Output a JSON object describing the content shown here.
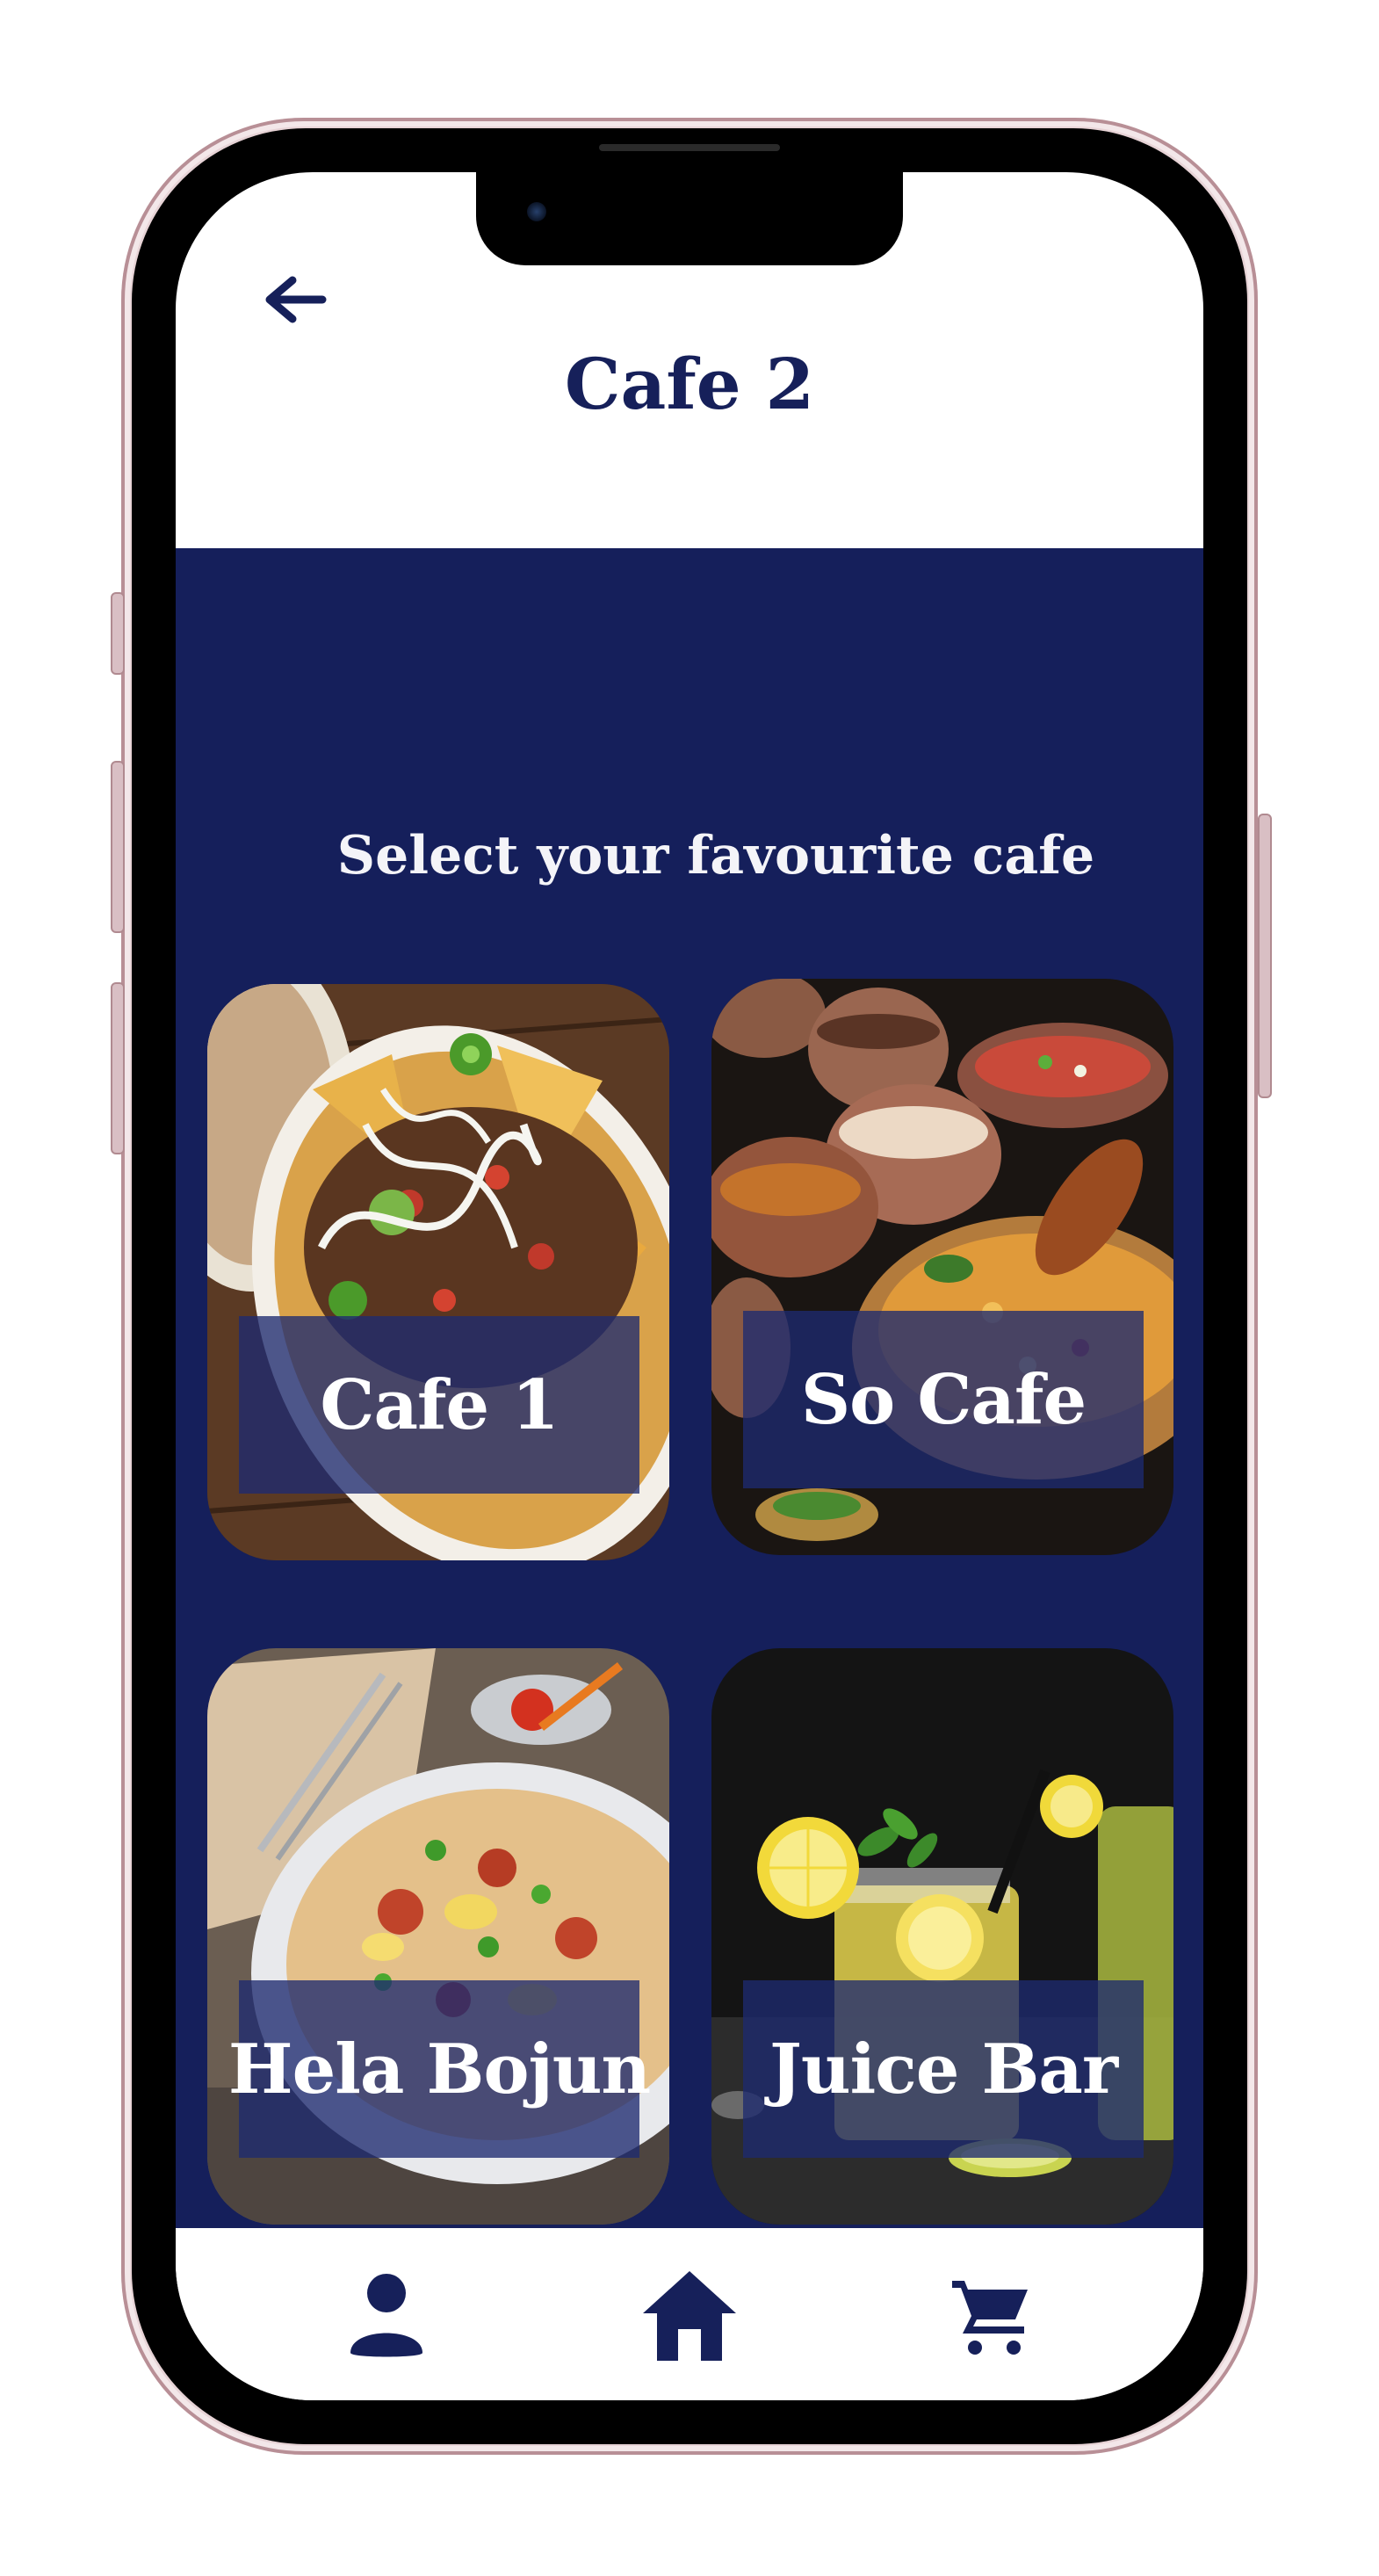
{
  "header": {
    "title": "Cafe 2",
    "back_icon": "arrow-left-icon"
  },
  "main": {
    "subtitle": "Select your favourite cafe",
    "cafes": [
      {
        "label": "Cafe 1",
        "image": "nachos-photo"
      },
      {
        "label": "So Cafe",
        "image": "biryani-photo"
      },
      {
        "label": "Hela Bojun",
        "image": "fried-rice-photo"
      },
      {
        "label": "Juice Bar",
        "image": "lemonade-photo"
      }
    ]
  },
  "bottom_nav": {
    "items": [
      {
        "icon": "person-icon"
      },
      {
        "icon": "home-icon"
      },
      {
        "icon": "cart-icon"
      }
    ]
  },
  "colors": {
    "primary_navy": "#151f5b",
    "title_navy": "#16205a",
    "label_overlay": "rgba(30,42,112,0.78)",
    "background": "#ffffff"
  }
}
